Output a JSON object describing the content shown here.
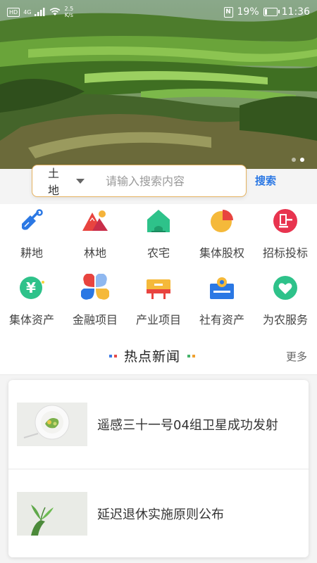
{
  "status_bar": {
    "hd": "HD",
    "network": "4G",
    "speed_value": "2.5",
    "speed_unit": "K/s",
    "nfc": "N",
    "battery_percent": "19%",
    "battery_level": 0.19,
    "time": "11:36"
  },
  "hero": {
    "slide_count": 2,
    "active_slide": 2
  },
  "search": {
    "category": "土地",
    "placeholder": "请输入搜索内容",
    "button_label": "搜索",
    "border_color": "#e5b25f"
  },
  "categories": [
    {
      "label": "耕地",
      "icon": "shovel-icon"
    },
    {
      "label": "林地",
      "icon": "mountain-icon"
    },
    {
      "label": "农宅",
      "icon": "house-icon"
    },
    {
      "label": "集体股权",
      "icon": "pie-chart-icon"
    },
    {
      "label": "招标投标",
      "icon": "gavel-icon"
    },
    {
      "label": "集体资产",
      "icon": "yen-icon"
    },
    {
      "label": "金融项目",
      "icon": "four-petal-icon"
    },
    {
      "label": "产业项目",
      "icon": "industry-icon"
    },
    {
      "label": "社有资产",
      "icon": "cooperative-asset-icon"
    },
    {
      "label": "为农服务",
      "icon": "heart-icon"
    }
  ],
  "news": {
    "title": "热点新闻",
    "more_label": "更多",
    "items": [
      {
        "title": "遥感三十一号04组卫星成功发射",
        "thumb": "plate-of-greens-image"
      },
      {
        "title": "延迟退休实施原则公布",
        "thumb": "plant-sprout-image"
      }
    ]
  },
  "colors": {
    "accent_blue": "#2b78e4",
    "dot_blue": "#3b7ae6",
    "dot_red": "#e54a4a",
    "dot_green": "#45b36b",
    "dot_orange": "#f0a030"
  }
}
